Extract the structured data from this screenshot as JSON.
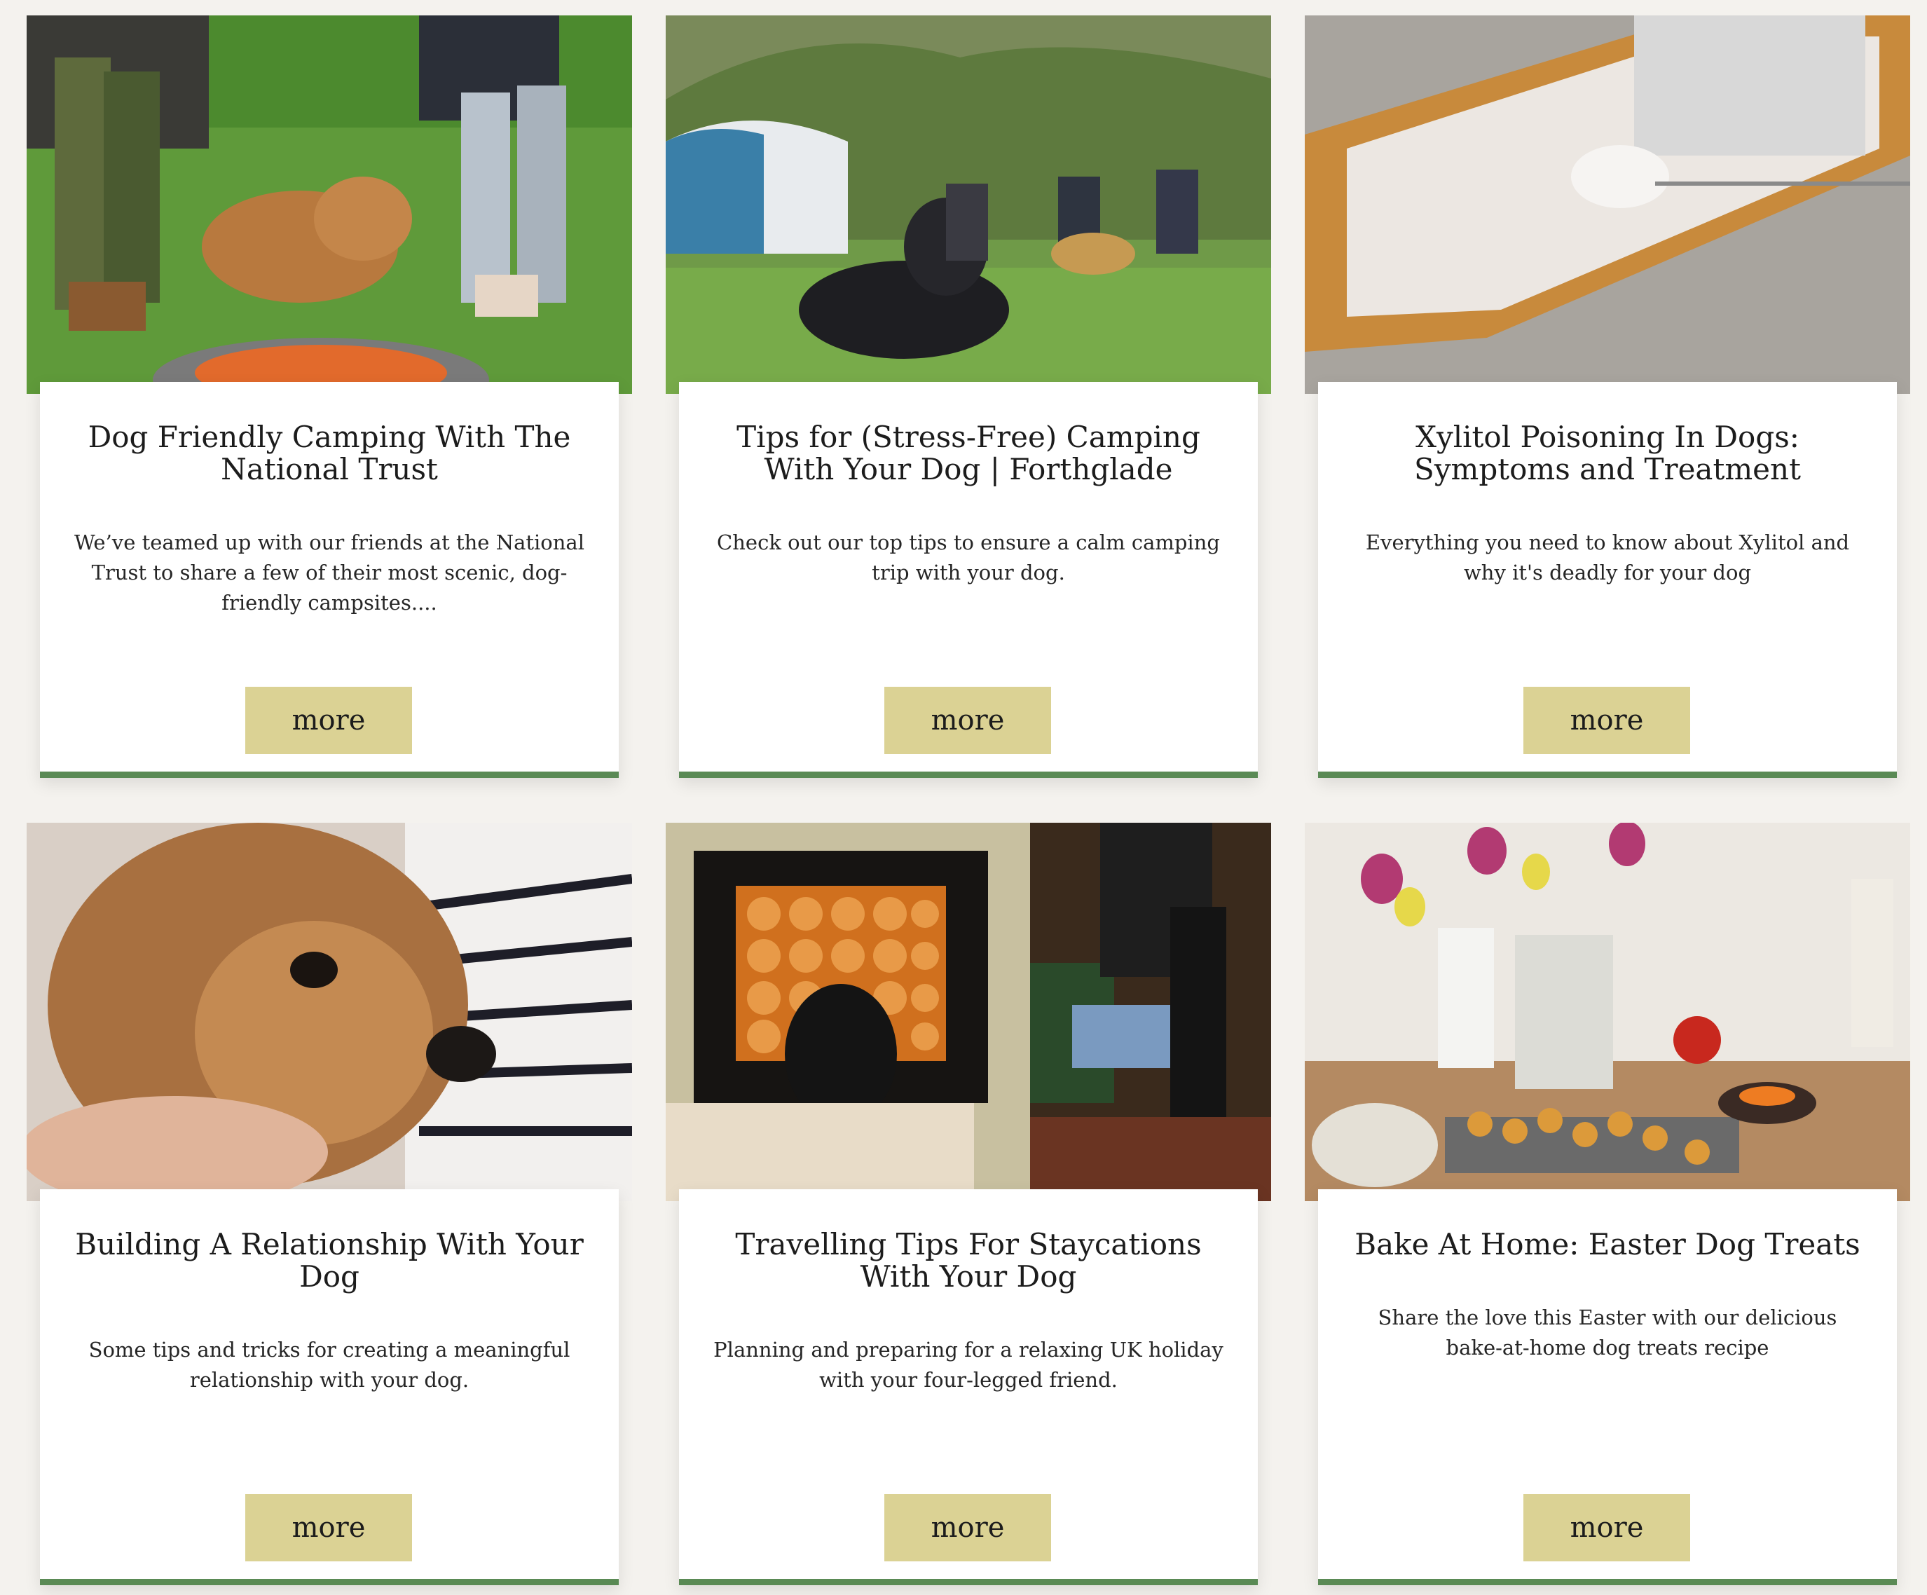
{
  "cards": [
    {
      "image_alt": "Dog Friendly Camping With The National Trust",
      "title": "Dog Friendly Camping With The National Trust",
      "description": "We’ve teamed up with our friends at the National Trust to share a few of their most scenic, dog-friendly campsites....",
      "button": "more"
    },
    {
      "image_alt": "Tips for (Stress-Free) Camping With Your Dog | Forthglade",
      "title": "Tips for (Stress-Free) Camping With Your Dog | Forthglade",
      "description": "Check out our top tips to ensure a calm camping trip with your dog.",
      "button": "more"
    },
    {
      "image_alt": "Xylitol Poisoning In Dogs: Symptoms and Treatment",
      "title": "Xylitol Poisoning In Dogs: Symptoms and Treatment",
      "description": "Everything you need to know about Xylitol and why it's deadly for your dog",
      "button": "more"
    },
    {
      "image_alt": "Building A Relationship With Your Dog",
      "title": "Building A Relationship With Your Dog",
      "description": "Some tips and tricks for creating a meaningful relationship with your dog.",
      "button": "more"
    },
    {
      "image_alt": "Travelling Tips For Staycations With Your Dog",
      "title": "Travelling Tips For Staycations With Your Dog",
      "description": "Planning and preparing for a relaxing UK holiday with your four-legged friend.",
      "button": "more"
    },
    {
      "image_alt": "Bake At Home: Easter Dog Treats",
      "title": "Bake At Home: Easter Dog Treats",
      "description": "Share the love this Easter with our delicious bake-at-home dog treats recipe",
      "button": "more"
    }
  ],
  "colors": {
    "page_background": "#f4f2ee",
    "card_background": "#ffffff",
    "accent_border": "#5a8a55",
    "button_background": "#dbd294",
    "text": "#1c1c1c"
  }
}
